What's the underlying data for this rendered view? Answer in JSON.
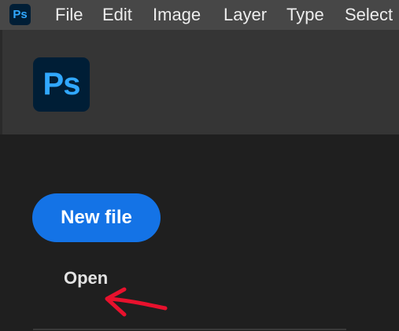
{
  "menubar": {
    "app_icon": "Ps",
    "items": [
      "File",
      "Edit",
      "Image",
      "Layer",
      "Type",
      "Select"
    ]
  },
  "header": {
    "app_icon": "Ps"
  },
  "home": {
    "new_file_label": "New file",
    "open_label": "Open"
  },
  "colors": {
    "menubar_bg": "#474747",
    "header_bg": "#353535",
    "body_bg": "#1f1f1f",
    "ps_icon_bg": "#001e36",
    "ps_icon_fg": "#31a8ff",
    "primary_button": "#1473e6",
    "annotation": "#e8112d"
  },
  "annotation": {
    "icon": "red-arrow-pointing-left"
  }
}
